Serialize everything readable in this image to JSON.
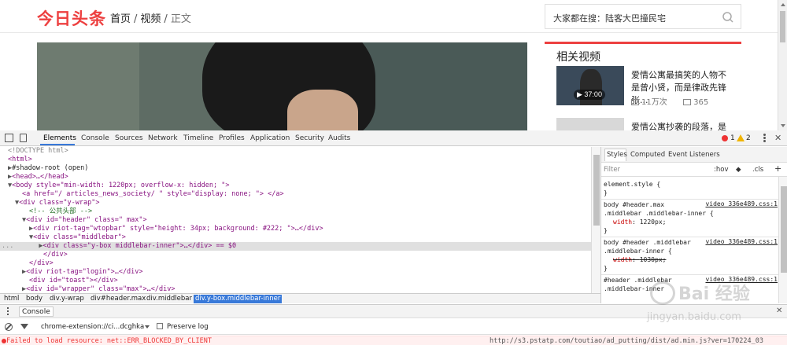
{
  "page": {
    "logo": "今日头条",
    "breadcrumb": {
      "home": "首页",
      "sep1": "/",
      "video": "视频",
      "sep2": "/",
      "current": "正文"
    },
    "search": {
      "placeholder": "大家都在搜：陆客大巴撞民宅"
    },
    "related": {
      "title": "相关视频",
      "items": [
        {
          "title": "爱情公寓最搞笑的人物不是曾小贤，而是律政先锋张...",
          "duration": "37:00",
          "views": "11万次",
          "comments": "365"
        },
        {
          "title": "爱情公寓抄袭的段落，是不"
        }
      ]
    }
  },
  "devtools": {
    "tabs": [
      "Elements",
      "Console",
      "Sources",
      "Network",
      "Timeline",
      "Profiles",
      "Application",
      "Security",
      "Audits"
    ],
    "errors": "1",
    "warnings": "2",
    "dom_lines": [
      {
        "text": "<!DOCTYPE html>"
      },
      {
        "text": "<html>"
      },
      {
        "text": "#shadow-root (open)"
      },
      {
        "text": "<head>…</head>"
      },
      {
        "text": "<body style=\"min-width: 1220px; overflow-x: hidden; \">"
      },
      {
        "text": "<a href=\"/ articles_news_society/ \" style=\"display: none; \"> </a>"
      },
      {
        "text": "<div class=\"y-wrap\">"
      },
      {
        "text": "<!-- 公共头部 -->"
      },
      {
        "text": "<div id=\"header\" class=\" max\">"
      },
      {
        "text": "<div riot-tag=\"wtopbar\" style=\"height: 34px; background: #222; \">…</div>"
      },
      {
        "text": "<div class=\"middlebar\">"
      },
      {
        "text": "<div class=\"y-box middlebar-inner\">…</div> == $0"
      },
      {
        "text": "</div>"
      },
      {
        "text": "</div>"
      },
      {
        "text": "<div riot-tag=\"login\">…</div>"
      },
      {
        "text": "<div id=\"toast\"></div>"
      },
      {
        "text": "<div id=\"wrapper\" class=\"max\">…</div>"
      }
    ],
    "crumbs": [
      "html",
      "body",
      "div.y-wrap",
      "div#header.max",
      "div.middlebar",
      "div.y-box.middlebar-inner"
    ],
    "styles": {
      "tabs": [
        "Styles",
        "Computed",
        "Event Listeners"
      ],
      "filter_placeholder": "Filter",
      "hov": ":hov",
      "cls": ".cls",
      "plus": "+",
      "rules": [
        {
          "selector": "element.style {",
          "close": "}"
        },
        {
          "selector": "body #header.max",
          "selector2": ".middlebar .middlebar-inner {",
          "source": "video_336e489.css:1",
          "prop": "width",
          "value": "1220px;",
          "close": "}"
        },
        {
          "selector": "body #header .middlebar",
          "selector2": ".middlebar-inner {",
          "source": "video_336e489.css:1",
          "prop": "width",
          "value": "1030px;",
          "close": "}"
        },
        {
          "selector": "#header .middlebar",
          "selector2": ".middlebar-inner",
          "source": "video_336e489.css:1"
        }
      ]
    },
    "console": {
      "label": "Console",
      "context": "chrome-extension://ci...dcghka",
      "preserve_log": "Preserve log",
      "error": "Failed to load resource: net::ERR_BLOCKED_BY_CLIENT",
      "error_url": "http://s3.pstatp.com/toutiao/ad_putting/dist/ad.min.js?ver=170224_03"
    }
  },
  "watermark": {
    "text1": "Bai 经验",
    "text2": "jingyan.baidu.com"
  },
  "colors": {
    "brand": "#ed4040",
    "selection": "#3879d9",
    "tag": "#881280",
    "attr": "#994500",
    "attr_value": "#1a1aa6"
  }
}
